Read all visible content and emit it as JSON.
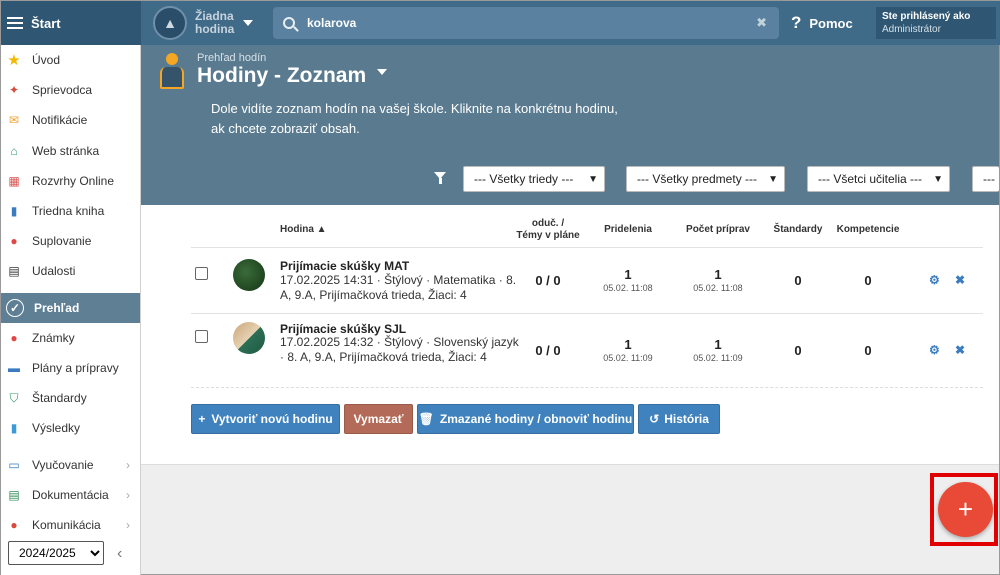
{
  "topbar": {
    "start_label": "Štart",
    "class_line1": "Žiadna",
    "class_line2": "hodina",
    "search_value": "kolarova",
    "help_label": "Pomoc",
    "user_line1": "Ste prihlásený ako",
    "user_line2": "Administrátor"
  },
  "sidebar": {
    "items": [
      {
        "label": "Úvod",
        "icon": "star-icon",
        "color": "#f5b800"
      },
      {
        "label": "Sprievodca",
        "icon": "magic-wand-icon",
        "color": "#d94a3a"
      },
      {
        "label": "Notifikácie",
        "icon": "envelope-icon",
        "color": "#f0a030"
      },
      {
        "label": "Web stránka",
        "icon": "home-icon",
        "color": "#2e9b6a"
      },
      {
        "label": "Rozvrhy Online",
        "icon": "timetable-icon",
        "color": "#d9534f"
      },
      {
        "label": "Triedna kniha",
        "icon": "book-icon",
        "color": "#3b7bbf"
      },
      {
        "label": "Suplovanie",
        "icon": "person-icon",
        "color": "#e04848"
      },
      {
        "label": "Udalosti",
        "icon": "calendar-icon",
        "color": "#333333"
      },
      {
        "label": "Prehľad",
        "icon": "check-circle-icon",
        "color": "#ffffff"
      },
      {
        "label": "Známky",
        "icon": "grades-icon",
        "color": "#e04848"
      },
      {
        "label": "Plány a prípravy",
        "icon": "briefcase-icon",
        "color": "#3b7bbf"
      },
      {
        "label": "Štandardy",
        "icon": "shield-icon",
        "color": "#2e9b6a"
      },
      {
        "label": "Výsledky",
        "icon": "bar-chart-icon",
        "color": "#3b9bd9"
      },
      {
        "label": "Vyučovanie",
        "icon": "open-book-icon",
        "color": "#3b7bbf"
      },
      {
        "label": "Dokumentácia",
        "icon": "document-icon",
        "color": "#2e8b57"
      },
      {
        "label": "Komunikácia",
        "icon": "chat-icon",
        "color": "#d94a3a"
      }
    ],
    "year": "2024/2025"
  },
  "header": {
    "breadcrumb": "Prehľad hodín",
    "title": "Hodiny - Zoznam",
    "intro": "Dole vidíte zoznam hodín na vašej škole. Kliknite na konkrétnu hodinu, ak chcete zobraziť obsah.",
    "filters": [
      "--- Všetky triedy ---",
      "--- Všetky predmety ---",
      "--- Všetci učitelia ---",
      "---"
    ]
  },
  "table": {
    "columns": {
      "hodina": "Hodina ▲",
      "odu_line1": "oduč. /",
      "odu_line2": "Témy v pláne",
      "pridelenia": "Pridelenia",
      "pocet": "Počet príprav",
      "standardy": "Štandardy",
      "kompetencie": "Kompetencie"
    },
    "rows": [
      {
        "title": "Prijímacie skúšky MAT",
        "sub": "17.02.2025 14:31 · Štýlový · Matematika · 8. A, 9.A, Prijímačková trieda, Žiaci: 4",
        "odu": "0 / 0",
        "pridelenia": "1",
        "pridelenia_date": "05.02. 11:08",
        "pocet": "1",
        "pocet_date": "05.02. 11:08",
        "standardy": "0",
        "kompetencie": "0"
      },
      {
        "title": "Prijímacie skúšky SJL",
        "sub": "17.02.2025 14:32 · Štýlový · Slovenský jazyk · 8. A, 9.A, Prijímačková trieda, Žiaci: 4",
        "odu": "0 / 0",
        "pridelenia": "1",
        "pridelenia_date": "05.02. 11:09",
        "pocet": "1",
        "pocet_date": "05.02. 11:09",
        "standardy": "0",
        "kompetencie": "0"
      }
    ]
  },
  "buttons": {
    "create": "Vytvoriť novú hodinu",
    "delete": "Vymazať",
    "deleted": "Zmazané hodiny / obnoviť hodinu",
    "history": "História"
  },
  "fab": {
    "label": "+"
  }
}
